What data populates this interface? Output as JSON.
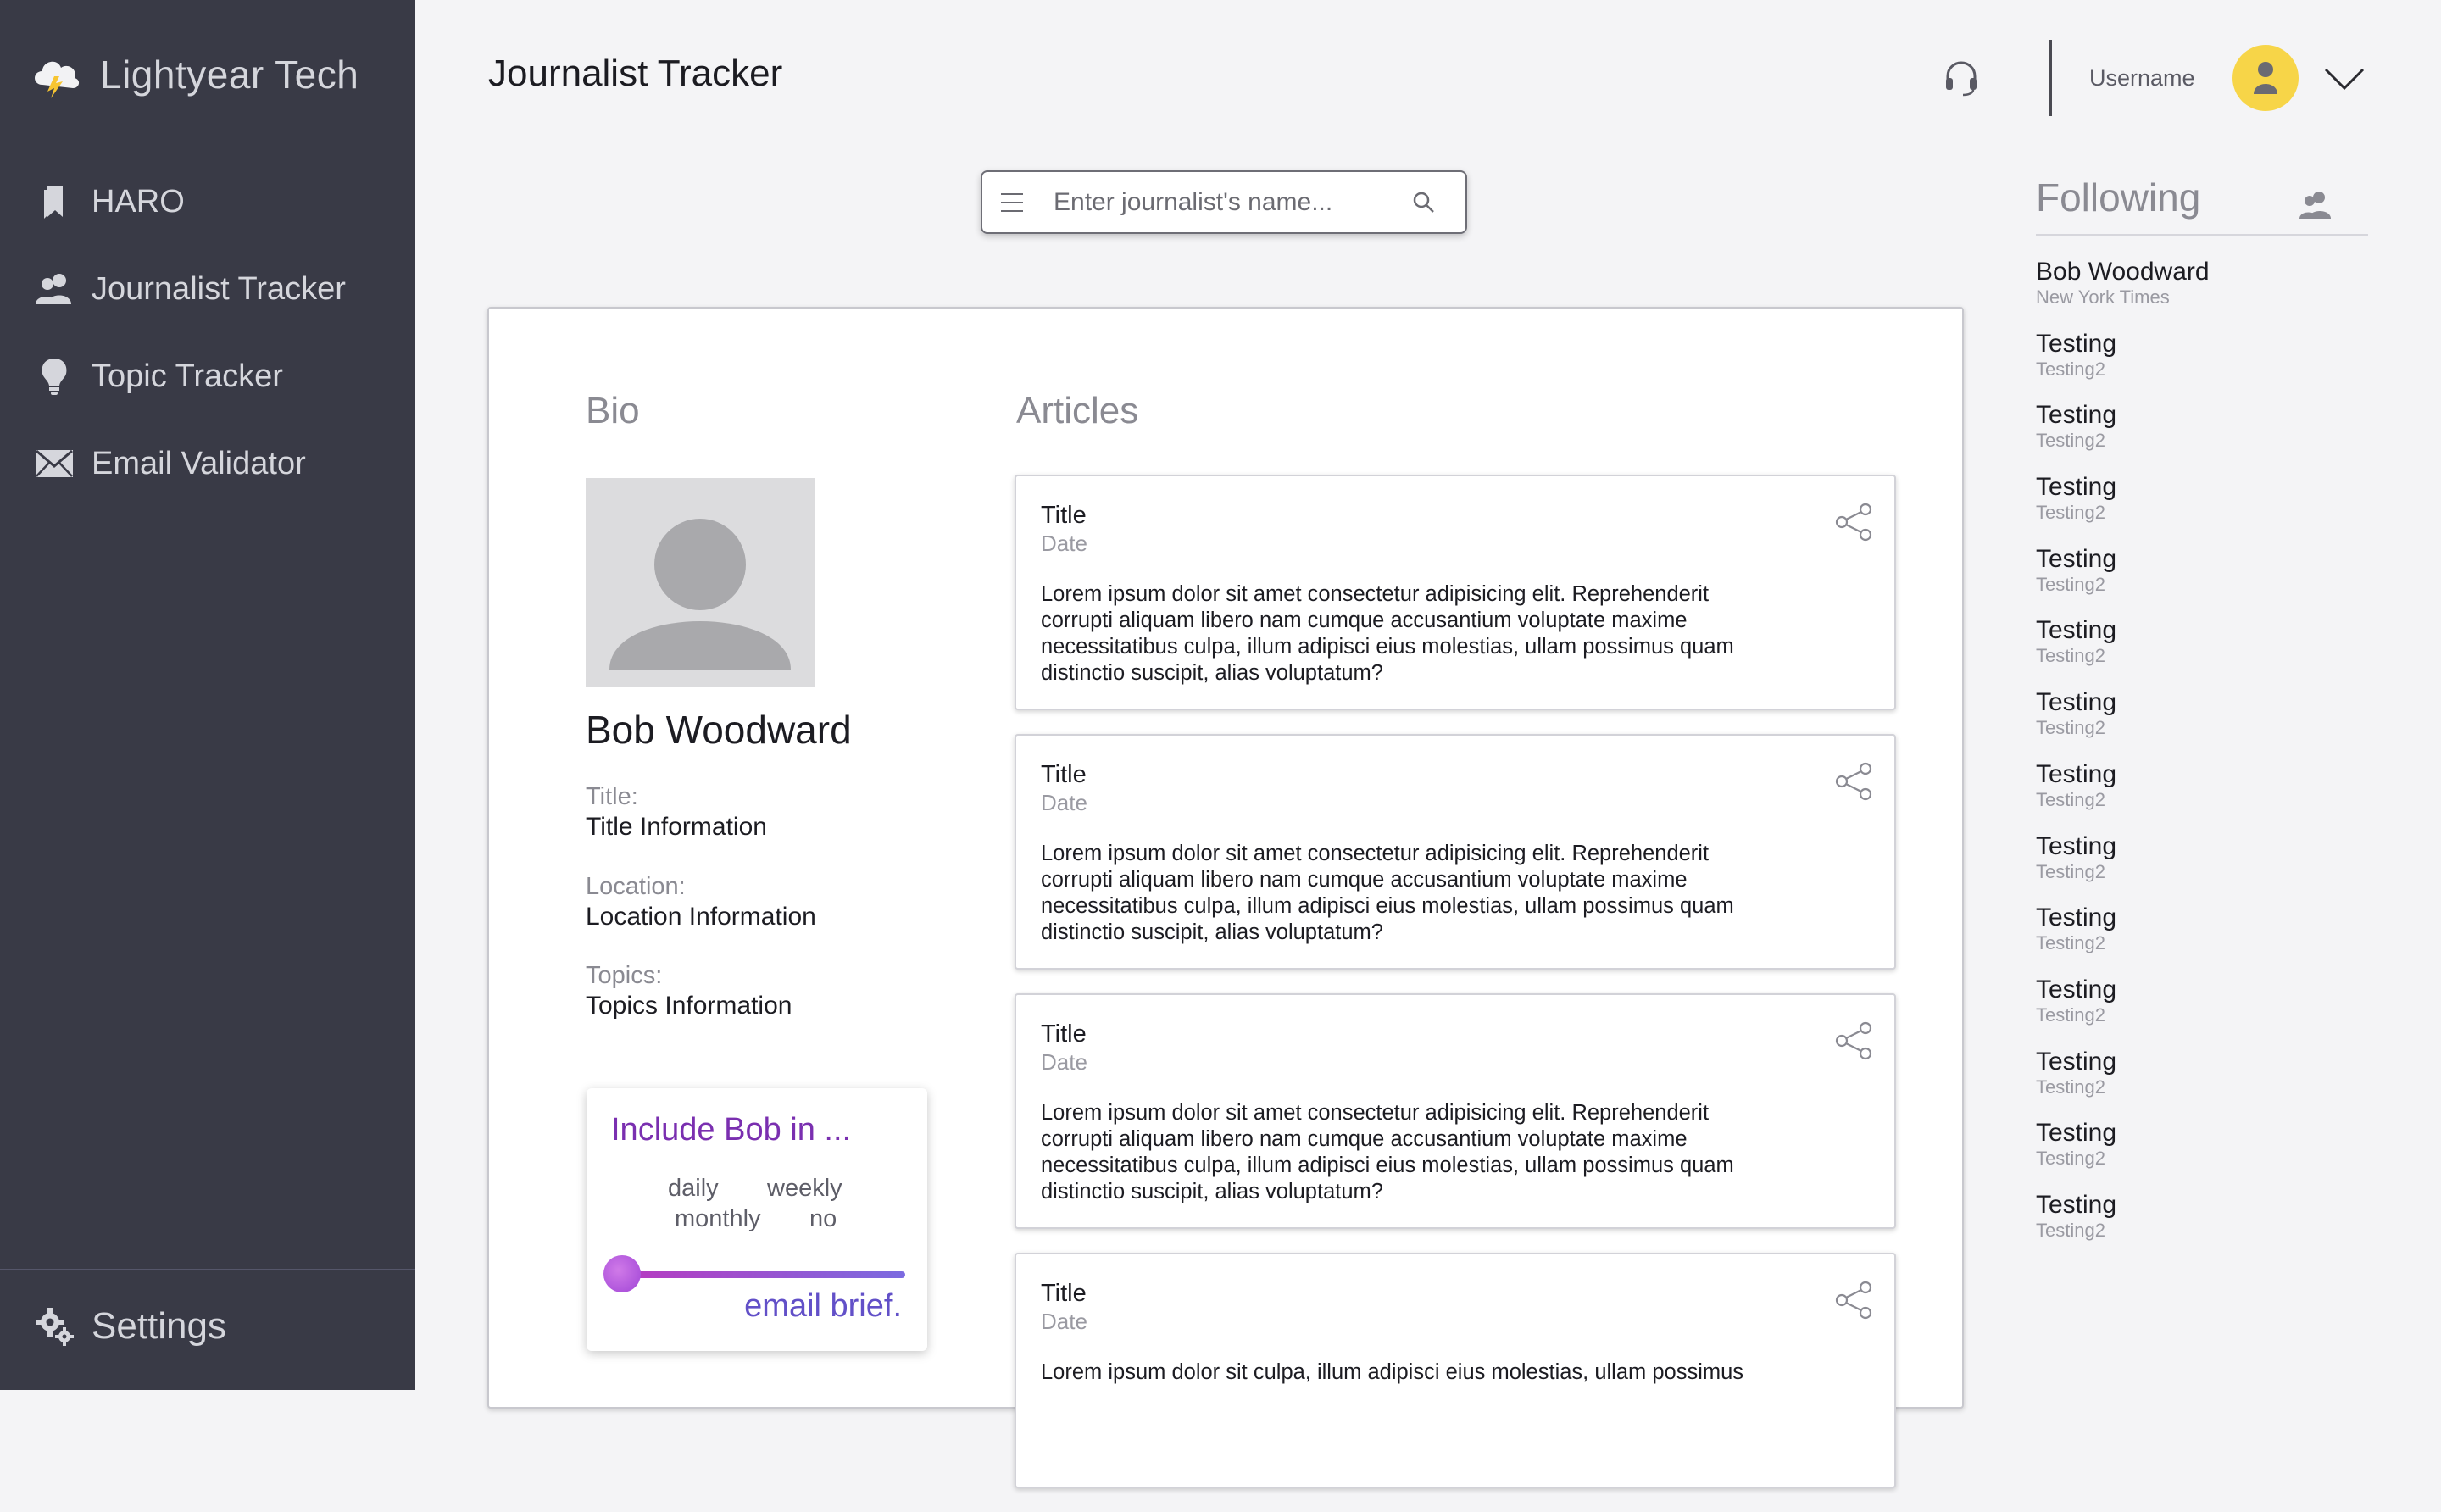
{
  "brand": {
    "name": "Lightyear Tech"
  },
  "sidebar": {
    "items": [
      {
        "label": "HARO",
        "icon": "bookmark-icon"
      },
      {
        "label": "Journalist Tracker",
        "icon": "users-icon"
      },
      {
        "label": "Topic Tracker",
        "icon": "lightbulb-icon"
      },
      {
        "label": "Email Validator",
        "icon": "envelope-icon"
      }
    ],
    "settings_label": "Settings"
  },
  "header": {
    "title": "Journalist Tracker",
    "username": "Username",
    "accent_color": "#f7d548"
  },
  "search": {
    "placeholder": "Enter journalist's name...",
    "value": ""
  },
  "bio": {
    "heading": "Bio",
    "name": "Bob Woodward",
    "fields": [
      {
        "label": "Title:",
        "value": "Title Information"
      },
      {
        "label": "Location:",
        "value": "Location Information"
      },
      {
        "label": "Topics:",
        "value": "Topics Information"
      }
    ]
  },
  "brief": {
    "title": "Include Bob in ...",
    "options": [
      "daily",
      "weekly",
      "monthly",
      "no"
    ],
    "footer": "email brief.",
    "slider_value": 0
  },
  "articles": {
    "heading": "Articles",
    "items": [
      {
        "title": "Title",
        "date": "Date",
        "body": "Lorem ipsum dolor sit amet consectetur adipisicing elit. Reprehenderit corrupti aliquam libero nam cumque accusantium voluptate maxime necessitatibus culpa, illum adipisci eius molestias, ullam possimus quam distinctio suscipit, alias voluptatum?"
      },
      {
        "title": "Title",
        "date": "Date",
        "body": "Lorem ipsum dolor sit amet consectetur adipisicing elit. Reprehenderit corrupti aliquam libero nam cumque accusantium voluptate maxime necessitatibus culpa, illum adipisci eius molestias, ullam possimus quam distinctio suscipit, alias voluptatum?"
      },
      {
        "title": "Title",
        "date": "Date",
        "body": "Lorem ipsum dolor sit amet consectetur adipisicing elit. Reprehenderit corrupti aliquam libero nam cumque accusantium voluptate maxime necessitatibus culpa, illum adipisci eius molestias, ullam possimus quam distinctio suscipit, alias voluptatum?"
      },
      {
        "title": "Title",
        "date": "Date",
        "body": "Lorem ipsum dolor sit culpa, illum adipisci eius molestias, ullam possimus"
      }
    ]
  },
  "following": {
    "title": "Following",
    "items": [
      {
        "name": "Bob Woodward",
        "sub": "New York Times"
      },
      {
        "name": "Testing",
        "sub": "Testing2"
      },
      {
        "name": "Testing",
        "sub": "Testing2"
      },
      {
        "name": "Testing",
        "sub": "Testing2"
      },
      {
        "name": "Testing",
        "sub": "Testing2"
      },
      {
        "name": "Testing",
        "sub": "Testing2"
      },
      {
        "name": "Testing",
        "sub": "Testing2"
      },
      {
        "name": "Testing",
        "sub": "Testing2"
      },
      {
        "name": "Testing",
        "sub": "Testing2"
      },
      {
        "name": "Testing",
        "sub": "Testing2"
      },
      {
        "name": "Testing",
        "sub": "Testing2"
      },
      {
        "name": "Testing",
        "sub": "Testing2"
      },
      {
        "name": "Testing",
        "sub": "Testing2"
      },
      {
        "name": "Testing",
        "sub": "Testing2"
      }
    ]
  }
}
